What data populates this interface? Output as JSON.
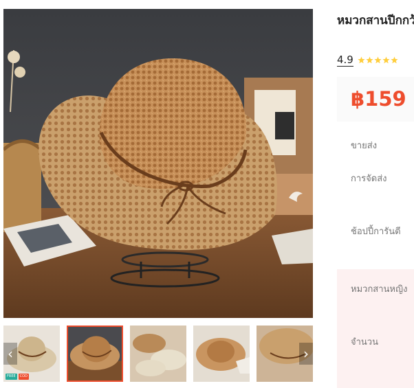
{
  "product": {
    "title": "หมวกสานปีกกว้าง พร้อมส่งจากไทย",
    "rating": "4.9",
    "stars": 5,
    "price": "฿159"
  },
  "details": {
    "wholesale_label": "ขายส่ง",
    "shipping_label": "การจัดส่ง",
    "guarantee_label": "ช้อปปี้การันตี",
    "variant_label": "หมวกสานหญิง",
    "quantity_label": "จำนวน"
  },
  "gallery": {
    "selected_index": 1,
    "thumb_count": 5,
    "badge_a": "FREE",
    "badge_b": "COD",
    "prev_arrow": "‹",
    "next_arrow": "›"
  },
  "colors": {
    "accent": "#ee4d2d",
    "star": "#ffce3d",
    "price_bg": "#fafafa",
    "variant_bg": "#fdf1f1"
  }
}
